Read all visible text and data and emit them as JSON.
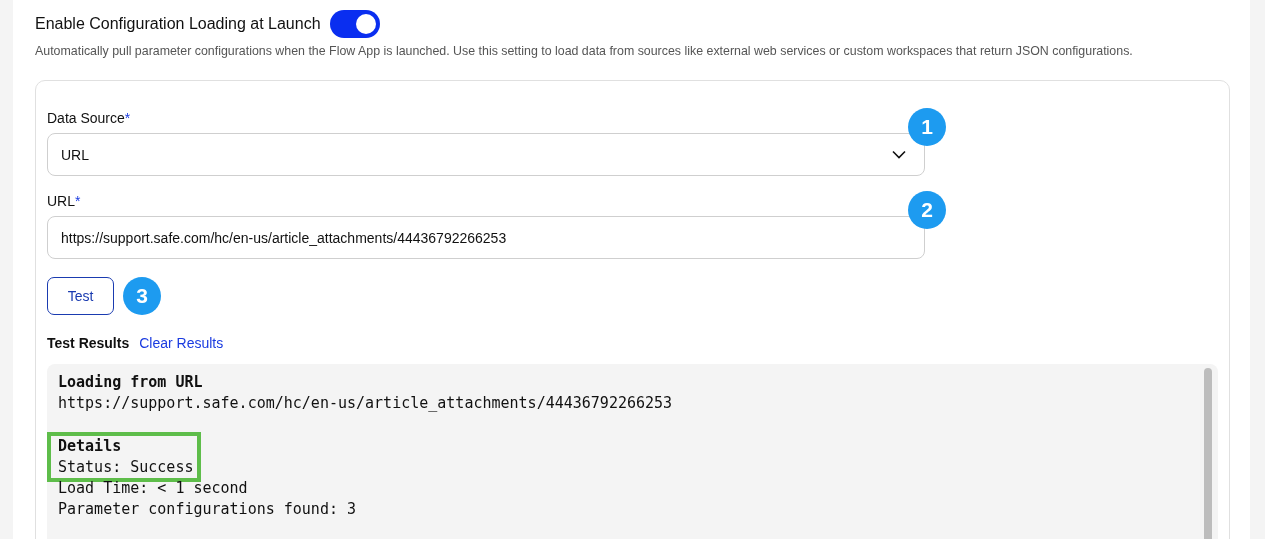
{
  "setting": {
    "label": "Enable Configuration Loading at Launch",
    "on": true,
    "description": "Automatically pull parameter configurations when the Flow App is launched. Use this setting to load data from sources like external web services or custom workspaces that return JSON configurations."
  },
  "fields": [
    {
      "kind": "select",
      "label": "Data Source",
      "required_mark": "*",
      "value": "URL",
      "callout": "1"
    },
    {
      "kind": "text",
      "label": "URL",
      "required_mark": "*",
      "value": "https://support.safe.com/hc/en-us/article_attachments/44436792266253",
      "callout": "2"
    }
  ],
  "test_button": {
    "label": "Test",
    "callout": "3"
  },
  "results": {
    "title": "Test Results",
    "clear_link": "Clear Results",
    "sections": [
      {
        "lines": [
          {
            "kind": "heading",
            "text": "Loading from URL"
          },
          {
            "kind": "text",
            "text": "https://support.safe.com/hc/en-us/article_attachments/44436792266253"
          }
        ]
      },
      {
        "highlighted_lines": [
          {
            "kind": "heading",
            "text": "Details"
          },
          {
            "kind": "text",
            "text": "Status: Success"
          }
        ],
        "lines": [
          {
            "kind": "text",
            "text": "Load Time: < 1 second"
          },
          {
            "kind": "text",
            "text": "Parameter configurations found: 3"
          }
        ]
      }
    ]
  }
}
